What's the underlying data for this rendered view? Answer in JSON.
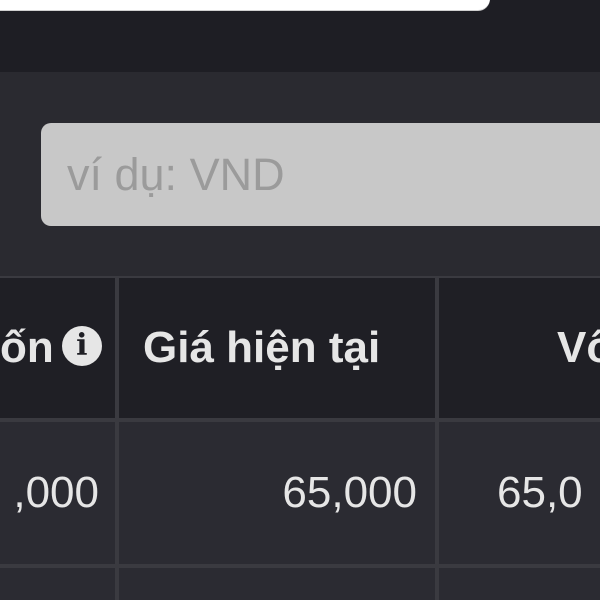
{
  "search": {
    "placeholder": "ví dụ: VND",
    "value": ""
  },
  "table": {
    "columns": [
      {
        "label": "ốn",
        "has_info": true,
        "info_icon": "info-icon"
      },
      {
        "label": "Giá hiện tại"
      },
      {
        "label": "Vố"
      }
    ],
    "rows": [
      [
        ",000",
        "65,000",
        "65,0"
      ]
    ]
  },
  "colors": {
    "background": "#1e1e24",
    "filter_band": "#2a2a30",
    "input_bg": "#c8c8c8",
    "header_bg": "#1f1f25",
    "row_bg": "#2b2b32",
    "text": "#e6e6e6"
  }
}
